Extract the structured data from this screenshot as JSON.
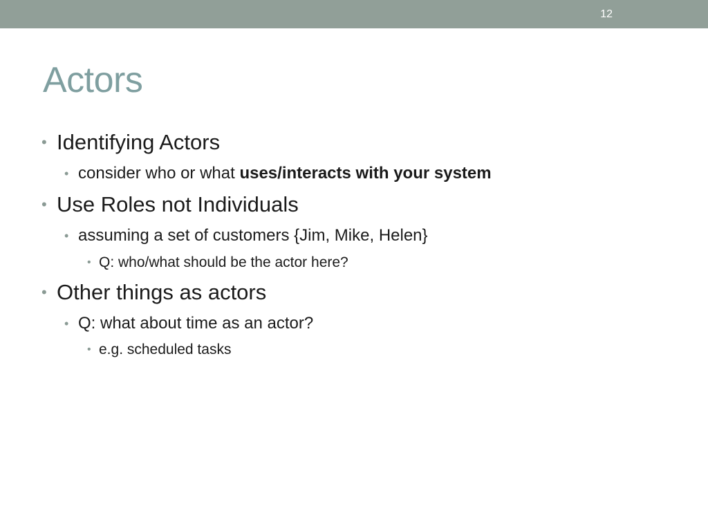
{
  "slide": {
    "number": "12",
    "title": "Actors",
    "bullet_glyph": "•",
    "accent_color": "#919f98",
    "title_color": "#7f9fa0"
  },
  "bullets": {
    "b1": {
      "text": "Identifying Actors"
    },
    "b1_1": {
      "text_plain": "consider who or what ",
      "text_bold": "uses/interacts with your system"
    },
    "b2": {
      "text": "Use Roles not Individuals"
    },
    "b2_1": {
      "text": "assuming a set of customers {Jim, Mike, Helen}"
    },
    "b2_1_1": {
      "text": "Q: who/what should be the actor here?"
    },
    "b3": {
      "text": "Other things as actors"
    },
    "b3_1": {
      "text": "Q: what about time as an actor?"
    },
    "b3_1_1": {
      "text": "e.g. scheduled tasks"
    }
  }
}
